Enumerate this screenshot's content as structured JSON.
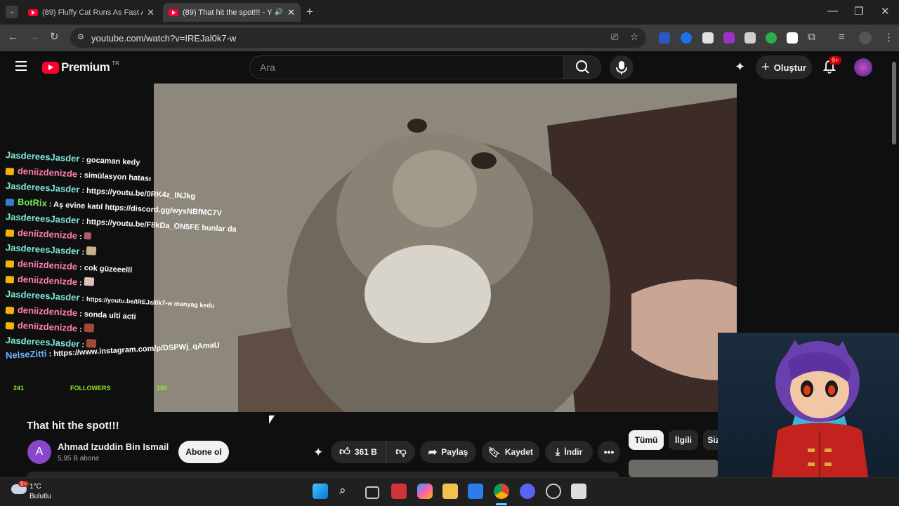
{
  "browser": {
    "tabs": [
      {
        "title": "(89) Fluffy Cat Runs As Fast As A",
        "active": false
      },
      {
        "title": "(89) That hit the spot!!! - Yo",
        "active": true
      }
    ],
    "url": "youtube.com/watch?v=IREJal0k7-w"
  },
  "youtube": {
    "logo_text": "Premium",
    "region": "TR",
    "search_placeholder": "Ara",
    "create_label": "Oluştur",
    "notification_count": "9+"
  },
  "chat": {
    "messages": [
      {
        "user": "JasdereesJasder",
        "text": "gocaman kedy",
        "color": "u1"
      },
      {
        "user": "deniizdenizde",
        "text": "simülasyon hatası",
        "color": "u2"
      },
      {
        "user": "JasdereesJasder",
        "text": "https://youtu.be/0RK4z_lNJkg",
        "color": "u1"
      },
      {
        "user": "BotRix",
        "text": "Aş evine katıl https://discord.gg/wysNBfMC7V",
        "color": "u3"
      },
      {
        "user": "JasdereesJasder",
        "text": "https://youtu.be/F8kDa_ON5FE bunlar da ii",
        "color": "u1"
      },
      {
        "user": "deniizdenizde",
        "text": "",
        "color": "u2"
      },
      {
        "user": "JasdereesJasder",
        "text": "",
        "color": "u1"
      },
      {
        "user": "deniizdenizde",
        "text": "cok güzeeelll",
        "color": "u2"
      },
      {
        "user": "deniizdenizde",
        "text": "",
        "color": "u2"
      },
      {
        "user": "JasdereesJasder",
        "text": "https://youtu.be/IREJal0k7-w manyag kedu",
        "color": "u1"
      },
      {
        "user": "deniizdenizde",
        "text": "sonda ulti acti",
        "color": "u2"
      },
      {
        "user": "deniizdenizde",
        "text": "",
        "color": "u2"
      },
      {
        "user": "JasdereesJasder",
        "text": "",
        "color": "u1"
      },
      {
        "user": "NelseZitti",
        "text": "https://www.instagram.com/p/DSPWj_qAmaU",
        "color": "u4"
      }
    ],
    "followers_left": "241",
    "followers_label": "FOLLOWERS",
    "followers_right": "200"
  },
  "video": {
    "title": "That hit the spot!!!",
    "channel": "Ahmad Izuddin Bin Ismail",
    "channel_initial": "A",
    "subscribers": "5,95 B abone",
    "subscribe_label": "Abone ol",
    "likes": "361 B",
    "share_label": "Paylaş",
    "save_label": "Kaydet",
    "download_label": "İndir"
  },
  "chips": [
    "Tümü",
    "İlgili",
    "Siz"
  ],
  "taskbar": {
    "weather_temp": "1°C",
    "weather_desc": "Bulutlu",
    "weather_badge": "9+"
  },
  "colors": {
    "accent_red": "#ff0033",
    "link_blue": "#3ea6ff"
  }
}
